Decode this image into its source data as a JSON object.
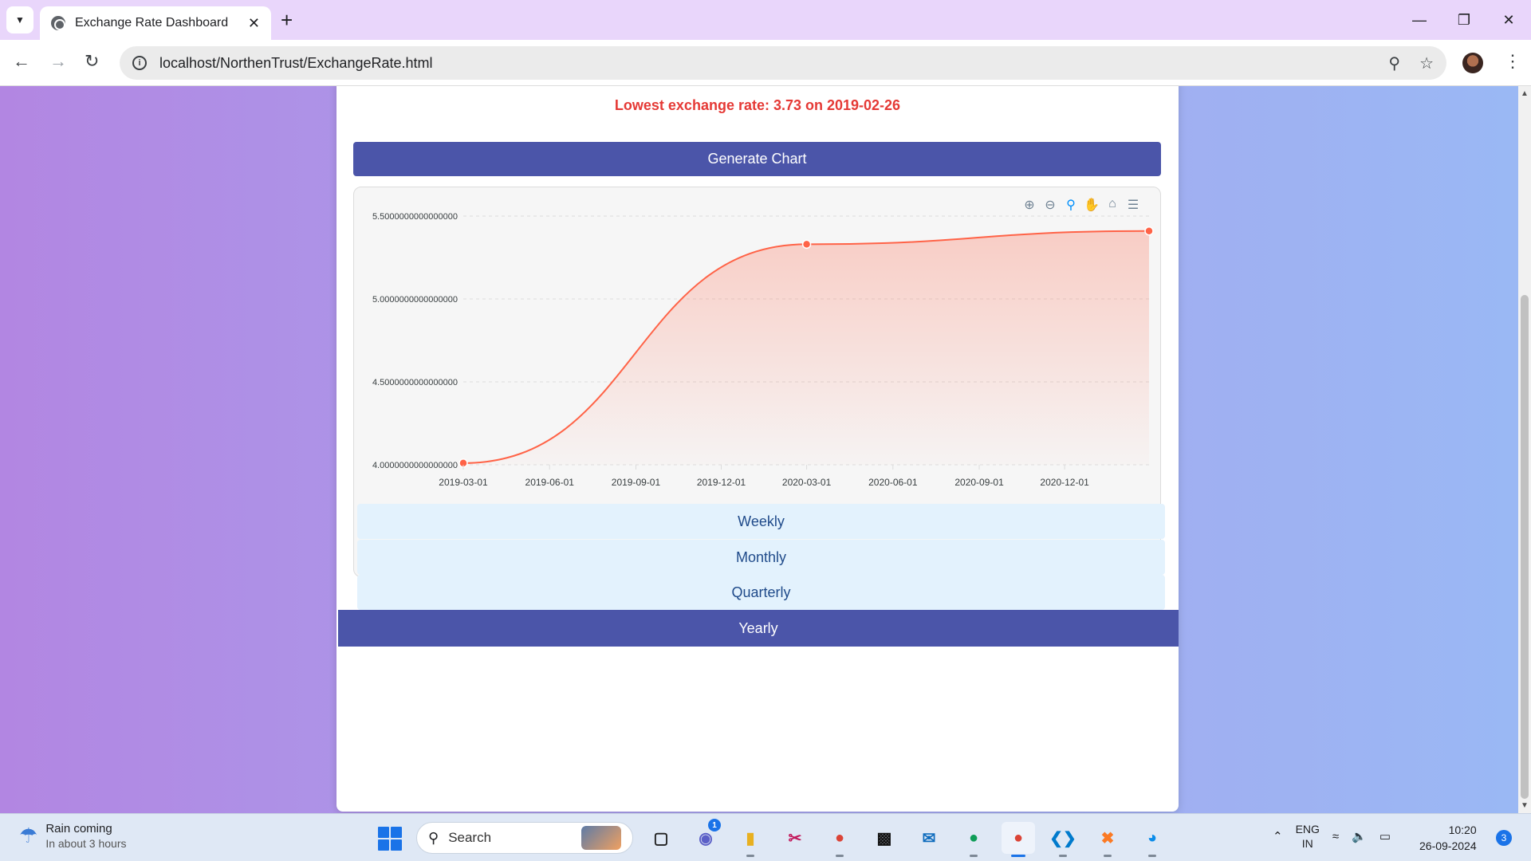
{
  "browser": {
    "tab_title": "Exchange Rate Dashboard",
    "url": "localhost/NorthenTrust/ExchangeRate.html"
  },
  "page": {
    "lowest_text": "Lowest exchange rate: 3.73 on 2019-02-26",
    "generate_label": "Generate Chart",
    "periods": [
      "Weekly",
      "Monthly",
      "Quarterly",
      "Yearly"
    ],
    "active_period": "Yearly"
  },
  "chart_data": {
    "type": "area",
    "x": [
      "2019-03-01",
      "2020-03-01",
      "2021-03-01"
    ],
    "y": [
      4.01,
      5.33,
      5.41
    ],
    "x_ticks": [
      "2019-03-01",
      "2019-06-01",
      "2019-09-01",
      "2019-12-01",
      "2020-03-01",
      "2020-06-01",
      "2020-09-01",
      "2020-12-01"
    ],
    "y_ticks": [
      "5.5000000000000000",
      "5.0000000000000000",
      "4.5000000000000000",
      "4.0000000000000000"
    ],
    "ylim": [
      4.0,
      5.5
    ],
    "grid": true,
    "line_color": "#ff6347",
    "toolbar_icons": [
      "zoom-in-icon",
      "zoom-out-icon",
      "zoom-selection-icon",
      "pan-hand-icon",
      "home-icon",
      "menu-icon"
    ]
  },
  "taskbar": {
    "weather_line1": "Rain coming",
    "weather_line2": "In about 3 hours",
    "search_placeholder": "Search",
    "lang_line1": "ENG",
    "lang_line2": "IN",
    "time": "10:20",
    "date": "26-09-2024",
    "notification_count": "3",
    "teams_badge": "1"
  }
}
